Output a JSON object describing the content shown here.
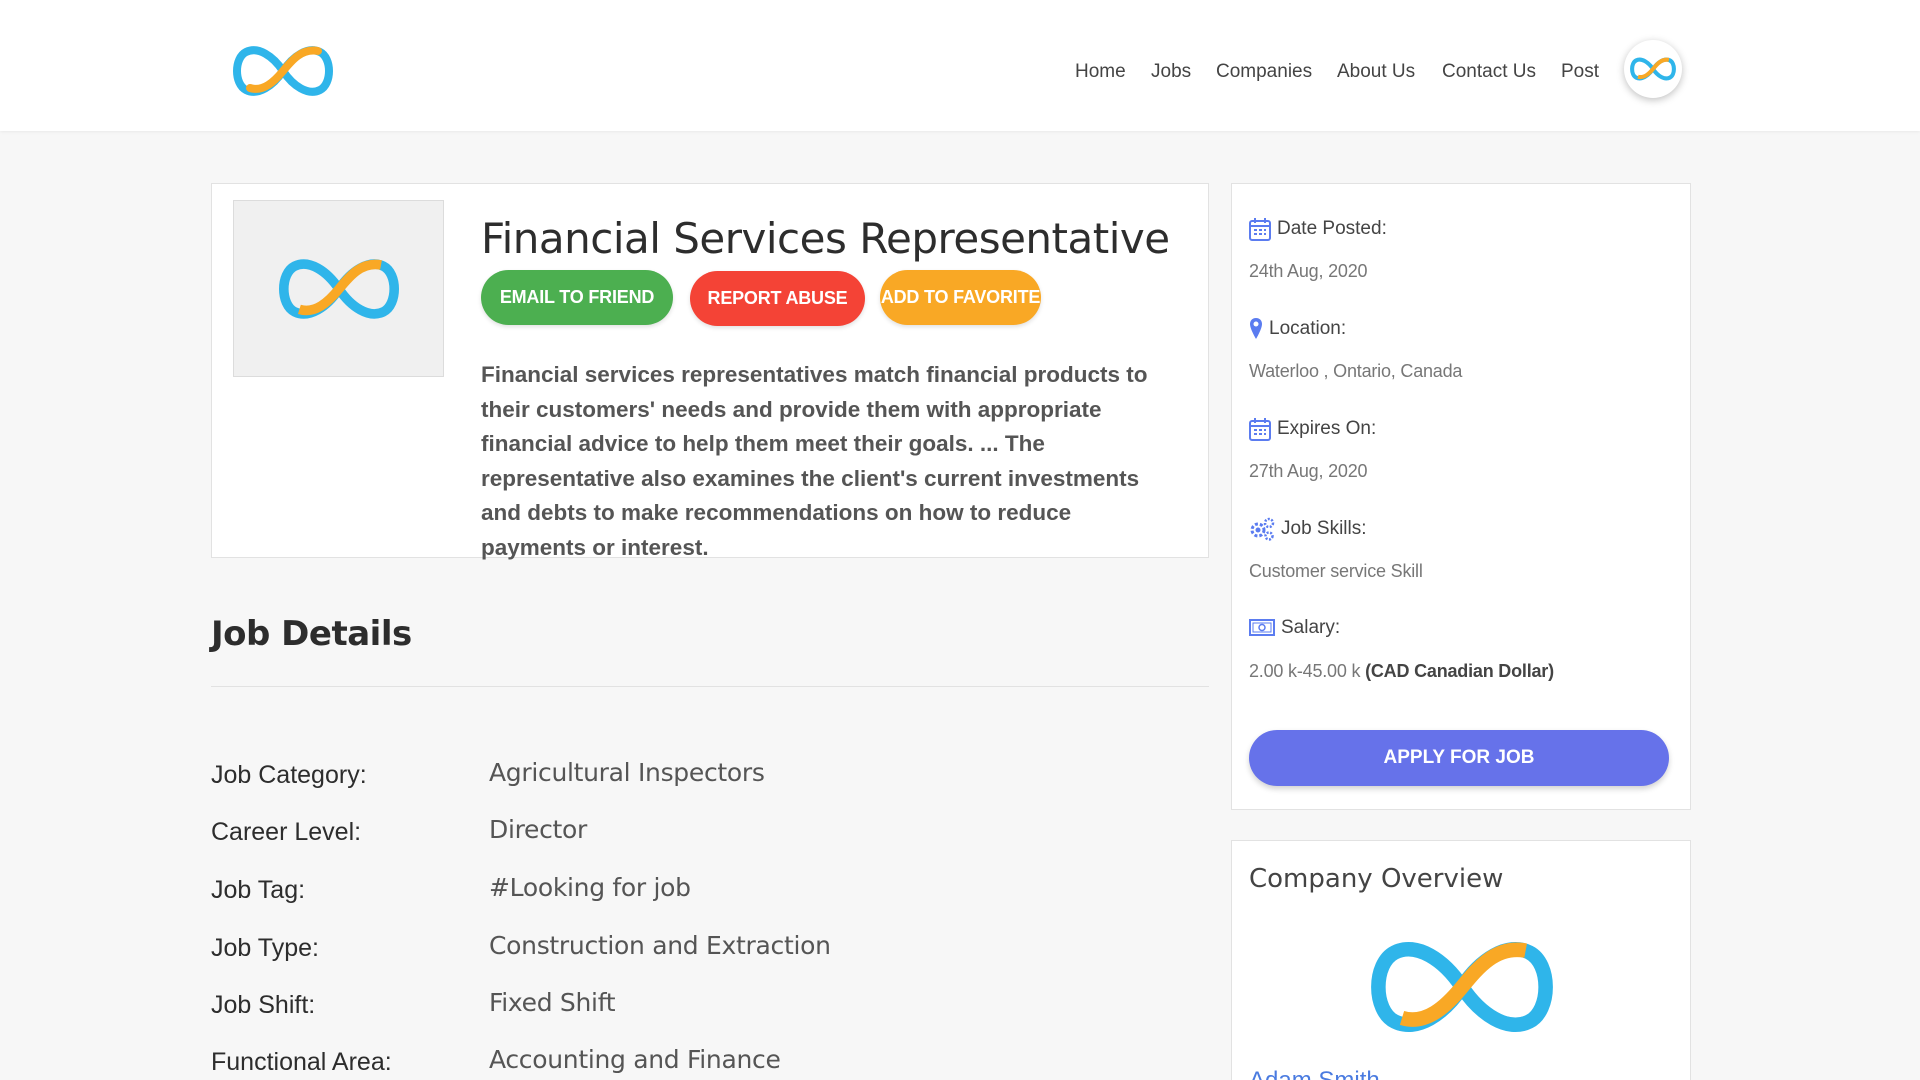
{
  "brand": {
    "primary": "#2fb5ea",
    "accent": "#f9a825"
  },
  "nav": {
    "items": [
      "Home",
      "Jobs",
      "Companies",
      "About Us",
      "Contact Us",
      "Post"
    ]
  },
  "job": {
    "title": "Financial Services Representative",
    "buttons": {
      "email": "EMAIL TO FRIEND",
      "report": "REPORT ABUSE",
      "favorite": "ADD TO FAVORITE"
    },
    "description": "Financial services representatives match financial products to their customers' needs and provide them with appropriate financial advice to help them meet their goals. ... The representative also examines the client's current investments and debts to make recommendations on how to reduce payments or interest."
  },
  "details": {
    "heading": "Job Details",
    "rows": [
      {
        "label": "Job Category:",
        "value": "Agricultural Inspectors"
      },
      {
        "label": "Career Level:",
        "value": "Director"
      },
      {
        "label": "Job Tag:",
        "value": "#Looking for job"
      },
      {
        "label": "Job Type:",
        "value": "Construction and Extraction"
      },
      {
        "label": "Job Shift:",
        "value": "Fixed Shift"
      },
      {
        "label": "Functional Area:",
        "value": "Accounting and Finance"
      }
    ]
  },
  "info": {
    "date_posted_label": "Date Posted:",
    "date_posted": "24th Aug, 2020",
    "location_label": "Location:",
    "location": "Waterloo , Ontario, Canada",
    "expires_label": "Expires On:",
    "expires": "27th Aug, 2020",
    "skills_label": "Job Skills:",
    "skills": "Customer service Skill",
    "salary_label": "Salary:",
    "salary_range": "2.00 k-45.00 k",
    "salary_currency": "(CAD Canadian Dollar)",
    "apply": "APPLY FOR JOB"
  },
  "overview": {
    "title": "Company Overview",
    "company_name": "Adam Smith"
  },
  "icons": [
    "infinity-logo-icon",
    "calendar-icon",
    "map-pin-icon",
    "gears-icon",
    "money-icon"
  ]
}
